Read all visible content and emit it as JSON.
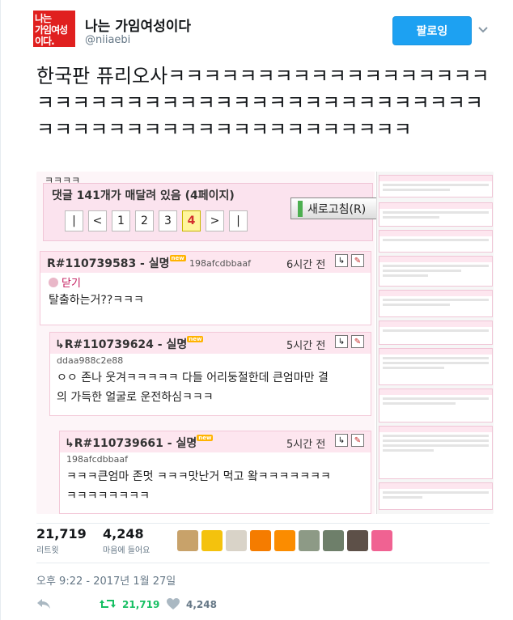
{
  "user": {
    "avatar_lines": [
      "나는",
      "가임여성",
      "이다."
    ],
    "display_name": "나는 가임여성이다",
    "handle": "@niiaebi"
  },
  "follow_label": "팔로잉",
  "tweet_text": "한국판 퓨리오사ㅋㅋㅋㅋㅋㅋㅋㅋㅋㅋㅋㅋㅋㅋㅋㅋㅋㅋㅋㅋㅋㅋㅋㅋㅋㅋㅋㅋㅋㅋㅋㅋㅋㅋㅋㅋㅋㅋㅋㅋㅋㅋㅋㅋㅋㅋㅋㅋㅋㅋㅋㅋㅋㅋㅋㅋㅋㅋㅋㅋㅋㅋㅋㅋ",
  "media": {
    "top_strip": "ㅋㅋㅋㅋ",
    "comment_count": "댓글 141개가 매달려 있음 (4페이지)",
    "pager": [
      "|",
      "<",
      "1",
      "2",
      "3",
      "4",
      ">",
      "|"
    ],
    "active_page": "4",
    "refresh_label": "새로고침(R)",
    "new_badge": "new",
    "comments": [
      {
        "rid": "R#110739583 - 실명",
        "ip": "198afcdbbaaf",
        "time": "6시간 전",
        "hide": "닫기",
        "body": "탈출하는거??ㅋㅋㅋ"
      },
      {
        "rid": "R#110739624 - 실명",
        "ip": "ddaa988c2e88",
        "time": "5시간 전",
        "body1": "ㅇㅇ 존나 웃겨ㅋㅋㅋㅋㅋ 다들 어리둥절한데 큰엄마만 결",
        "body2": "의 가득한 얼굴로 운전하심ㅋㅋㅋ"
      },
      {
        "rid": "R#110739661 - 실명",
        "ip": "198afcdbbaaf",
        "time": "5시간 전",
        "body1": "ㅋㅋㅋ큰엄마 존멋 ㅋㅋㅋ맛난거 먹고 왘ㅋㅋㅋㅋㅋㅋㅋ",
        "body2": "ㅋㅋㅋㅋㅋㅋㅋㅋ"
      }
    ]
  },
  "stats": {
    "retweets": "21,719",
    "retweets_label": "리트윗",
    "likes": "4,248",
    "likes_label": "마음에 들어요"
  },
  "timestamp": "오후 9:22 - 2017년 1월 27일",
  "actions": {
    "retweet_count": "21,719",
    "like_count": "4,248"
  },
  "colors": {
    "brand_blue": "#1da1f2",
    "retweet_green": "#17bf63",
    "avatar_red": "#e0201f"
  }
}
